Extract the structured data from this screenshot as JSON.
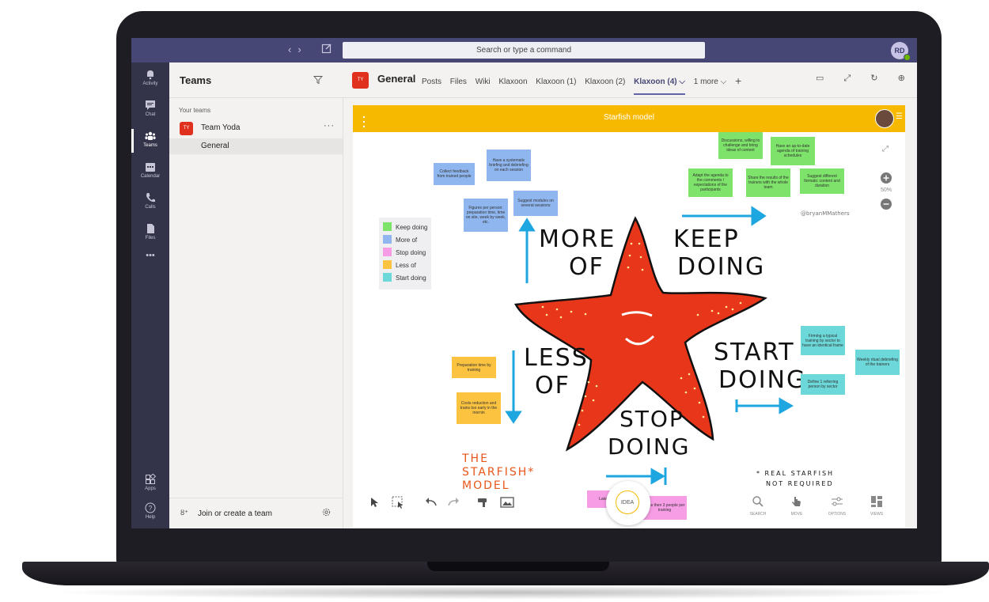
{
  "topbar": {
    "nav_back": "‹",
    "nav_forward": "›",
    "search_placeholder": "Search or type a command",
    "avatar_initials": "RD"
  },
  "rail": {
    "items": [
      {
        "label": "Activity",
        "icon": "bell-icon"
      },
      {
        "label": "Chat",
        "icon": "chat-icon"
      },
      {
        "label": "Teams",
        "icon": "teams-icon",
        "active": true
      },
      {
        "label": "Calendar",
        "icon": "calendar-icon"
      },
      {
        "label": "Calls",
        "icon": "phone-icon"
      },
      {
        "label": "Files",
        "icon": "file-icon"
      },
      {
        "label": "•••",
        "icon": "more-icon"
      }
    ],
    "apps_label": "Apps",
    "help_label": "Help"
  },
  "teams_panel": {
    "title": "Teams",
    "your_teams": "Your teams",
    "team": {
      "badge": "TY",
      "name": "Team Yoda",
      "more": "···"
    },
    "channel": "General",
    "join_label": "Join or create a team",
    "join_icon": "ȣ⁺"
  },
  "channel_header": {
    "badge": "TY",
    "title": "General",
    "tabs": [
      "Posts",
      "Files",
      "Wiki",
      "Klaxoon",
      "Klaxoon (1)",
      "Klaxoon (2)"
    ],
    "active_tab": "Klaxoon (4) ⌵",
    "more_tab": "1 more ⌵",
    "add_tab": "+",
    "icons": "▭ ⤢ ↻ ⊕ ···"
  },
  "board": {
    "title": "Starfish model",
    "menu_glyph": "☰",
    "legend": [
      {
        "label": "Keep doing",
        "color": "#7ee36a"
      },
      {
        "label": "More of",
        "color": "#8fb6ee"
      },
      {
        "label": "Stop doing",
        "color": "#f79de6"
      },
      {
        "label": "Less of",
        "color": "#fbc340"
      },
      {
        "label": "Start doing",
        "color": "#6cd8d9"
      }
    ],
    "notes": {
      "collect_feedback": "Collect feedback from trained people",
      "systematic_briefing": "Have a systematic briefing and debriefing on each session",
      "figures_per_person": "Figures per person: preparation time, time on site, week by week, etc.",
      "suggest_modules": "Suggest modules on several sessions",
      "discussions": "Discussions, willing to challenge and bring ideas of content",
      "uptodate_agenda": "Have an up-to-date agenda of training schedules",
      "adapt_agenda": "Adapt the agenda to the comments / expectations of the participants",
      "share_results": "Share the results of the trainers with the whole team",
      "suggest_formats": "Suggest different formats: content and duration",
      "firming_training": "Firming a typical training by sector to have an identical frame",
      "weekly_ritual": "Weekly ritual debriefing of the trainers",
      "define_referring": "Define 1 referring person by sector",
      "preparation_time": "Preparation time by training",
      "costs_reduction": "Costs reduction and trains too early in the mornin",
      "late": "Late",
      "less_than_3": "Less then 3 people per training"
    },
    "drawing": {
      "more_of_1": "MORE",
      "more_of_2": "OF",
      "keep_doing_1": "KEEP",
      "keep_doing_2": "DOING",
      "less_of_1": "LESS",
      "less_of_2": "OF",
      "start_doing_1": "START",
      "start_doing_2": "DOING",
      "stop_doing_1": "STOP",
      "stop_doing_2": "DOING",
      "model_1": "THE",
      "model_2": "STARFISH*",
      "model_3": "MODEL",
      "footnote_1": "* REAL STARFISH",
      "footnote_2": "NOT REQUIRED",
      "signature": "@bryanMMathers"
    },
    "zoom": "50%",
    "idea_label": "IDEA",
    "tools": [
      {
        "label": "SEARCH",
        "icon": "search-icon"
      },
      {
        "label": "MOVE",
        "icon": "move-icon"
      },
      {
        "label": "OPTIONS",
        "icon": "options-icon"
      },
      {
        "label": "VIEWS",
        "icon": "views-icon"
      }
    ]
  }
}
